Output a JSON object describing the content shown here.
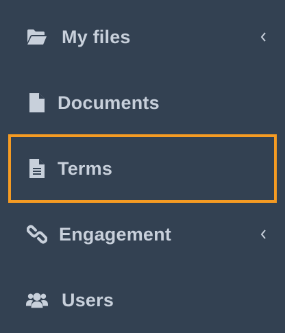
{
  "sidebar": {
    "items": [
      {
        "label": "My files",
        "icon": "folder-open-icon",
        "has_submenu": true
      },
      {
        "label": "Documents",
        "icon": "file-icon",
        "has_submenu": false
      },
      {
        "label": "Terms",
        "icon": "file-text-icon",
        "has_submenu": false,
        "highlighted": true
      },
      {
        "label": "Engagement",
        "icon": "link-icon",
        "has_submenu": true
      },
      {
        "label": "Users",
        "icon": "users-icon",
        "has_submenu": false
      }
    ]
  },
  "colors": {
    "background": "#334152",
    "text": "#c8d0db",
    "highlight_border": "#f59b23"
  }
}
